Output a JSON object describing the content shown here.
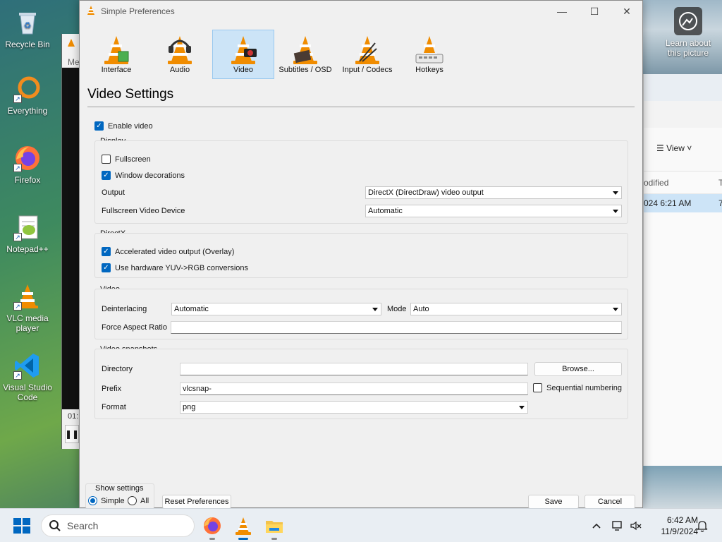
{
  "desktop": {
    "icons": [
      {
        "label": "Recycle Bin",
        "icon": "recycle-bin-icon"
      },
      {
        "label": "Everything",
        "icon": "everything-icon"
      },
      {
        "label": "Firefox",
        "icon": "firefox-icon"
      },
      {
        "label": "Notepad++",
        "icon": "notepad-plus-plus-icon"
      },
      {
        "label": "VLC media player",
        "icon": "vlc-icon"
      },
      {
        "label": "Visual Studio Code",
        "icon": "vscode-icon"
      }
    ],
    "learn_about": "Learn about this picture"
  },
  "background_windows": {
    "player_label_partial": "Me",
    "player_time_partial": "01:",
    "explorer": {
      "view_label": "View",
      "column_partial": "odified",
      "column_partial2": "T",
      "row_date_partial": "024 6:21 AM",
      "row_partial2": "7"
    }
  },
  "dialog": {
    "title": "Simple Preferences",
    "categories": [
      {
        "label": "Interface",
        "active": false
      },
      {
        "label": "Audio",
        "active": false
      },
      {
        "label": "Video",
        "active": true
      },
      {
        "label": "Subtitles / OSD",
        "active": false
      },
      {
        "label": "Input / Codecs",
        "active": false
      },
      {
        "label": "Hotkeys",
        "active": false
      }
    ],
    "section_title": "Video Settings",
    "enable_video": {
      "label": "Enable video",
      "checked": true
    },
    "display": {
      "group_label": "Display",
      "fullscreen": {
        "label": "Fullscreen",
        "checked": false
      },
      "window_decorations": {
        "label": "Window decorations",
        "checked": true
      },
      "output_label": "Output",
      "output_value": "DirectX (DirectDraw) video output",
      "fullscreen_device_label": "Fullscreen Video Device",
      "fullscreen_device_value": "Automatic"
    },
    "directx": {
      "group_label": "DirectX",
      "accelerated": {
        "label": "Accelerated video output (Overlay)",
        "checked": true
      },
      "yuv": {
        "label": "Use hardware YUV->RGB conversions",
        "checked": true
      }
    },
    "video": {
      "group_label": "Video",
      "deinterlacing_label": "Deinterlacing",
      "deinterlacing_value": "Automatic",
      "mode_label": "Mode",
      "mode_value": "Auto",
      "aspect_label": "Force Aspect Ratio",
      "aspect_value": ""
    },
    "snapshots": {
      "group_label": "Video snapshots",
      "directory_label": "Directory",
      "directory_value": "",
      "browse_label": "Browse...",
      "prefix_label": "Prefix",
      "prefix_value": "vlcsnap-",
      "sequential": {
        "label": "Sequential numbering",
        "checked": false
      },
      "format_label": "Format",
      "format_value": "png"
    },
    "show_settings": {
      "label": "Show settings",
      "simple_label": "Simple",
      "all_label": "All",
      "selected": "Simple"
    },
    "reset_label": "Reset Preferences",
    "save_label": "Save",
    "cancel_label": "Cancel"
  },
  "taskbar": {
    "search_placeholder": "Search",
    "time": "6:42 AM",
    "date": "11/9/2024"
  },
  "colors": {
    "accent": "#0067c0",
    "vlc_orange": "#f08c00",
    "selected_tab": "#cce4f7"
  }
}
